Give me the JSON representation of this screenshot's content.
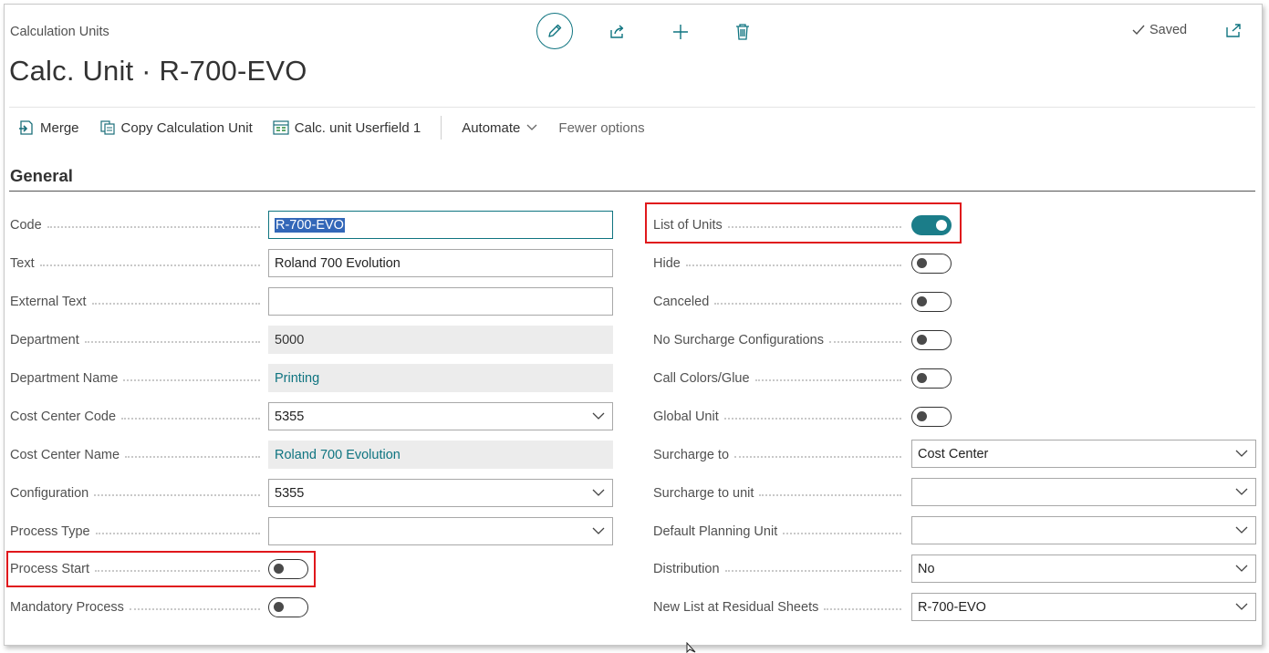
{
  "header": {
    "breadcrumb": "Calculation Units",
    "title": "Calc. Unit · R-700-EVO",
    "status": "Saved"
  },
  "toolbar": {
    "icons": [
      "edit-icon",
      "share-icon",
      "new-icon",
      "delete-icon",
      "open-in-new-window-icon"
    ]
  },
  "actions": {
    "merge": "Merge",
    "copy": "Copy Calculation Unit",
    "userfield": "Calc. unit Userfield 1",
    "automate": "Automate",
    "fewer": "Fewer options"
  },
  "section": {
    "title": "General"
  },
  "left": {
    "code": {
      "label": "Code",
      "value": "R-700-EVO"
    },
    "text": {
      "label": "Text",
      "value": "Roland 700 Evolution"
    },
    "external_text": {
      "label": "External Text",
      "value": ""
    },
    "department": {
      "label": "Department",
      "value": "5000"
    },
    "department_name": {
      "label": "Department Name",
      "value": "Printing"
    },
    "cost_center_code": {
      "label": "Cost Center Code",
      "value": "5355"
    },
    "cost_center_name": {
      "label": "Cost Center Name",
      "value": "Roland 700 Evolution"
    },
    "configuration": {
      "label": "Configuration",
      "value": "5355"
    },
    "process_type": {
      "label": "Process Type",
      "value": ""
    },
    "process_start": {
      "label": "Process Start",
      "on": false
    },
    "mandatory_process": {
      "label": "Mandatory Process",
      "on": false
    }
  },
  "right": {
    "list_of_units": {
      "label": "List of Units",
      "on": true
    },
    "hide": {
      "label": "Hide",
      "on": false
    },
    "canceled": {
      "label": "Canceled",
      "on": false
    },
    "no_surcharge": {
      "label": "No Surcharge Configurations",
      "on": false
    },
    "call_colors": {
      "label": "Call Colors/Glue",
      "on": false
    },
    "global_unit": {
      "label": "Global Unit",
      "on": false
    },
    "surcharge_to": {
      "label": "Surcharge to",
      "value": "Cost Center"
    },
    "surcharge_to_unit": {
      "label": "Surcharge to unit",
      "value": ""
    },
    "default_planning_unit": {
      "label": "Default Planning Unit",
      "value": ""
    },
    "distribution": {
      "label": "Distribution",
      "value": "No"
    },
    "new_list_residual": {
      "label": "New List at Residual Sheets",
      "value": "R-700-EVO"
    }
  },
  "colors": {
    "accent": "#0f7480",
    "toggle_on": "#1b7d89",
    "highlight": "#e0181c",
    "selection": "#3367b8"
  }
}
